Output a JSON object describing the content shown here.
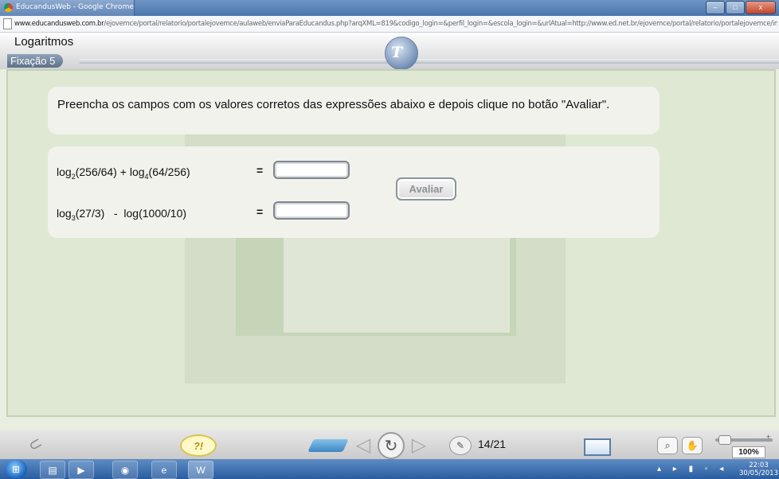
{
  "window": {
    "title": "EducandusWeb - Google Chrome",
    "minimize_glyph": "–",
    "maximize_glyph": "□",
    "close_glyph": "x"
  },
  "address_bar": {
    "url_host": "www.educandusweb.com.br",
    "url_path": "/ejovemce/portal/relatorio/portalejovemce/aulaweb/enviaParaEducandus.php?arqXML=819&codigo_login=&perfil_login=&escola_login=&urlAtual=http://www.ed.net.br/ejovemce/portal/relatorio/portalejovemce/index_9.p"
  },
  "header": {
    "title": "Logaritmos",
    "subtab": "Fixação 5",
    "logo_mark": "T"
  },
  "exercise": {
    "prompt": "Preencha os campos com os valores corretos das expressões abaixo e depois clique no botão \"Avaliar\".",
    "expr1": {
      "log1": "log",
      "base1": "2",
      "arg1": "(256/64)",
      "op": " + ",
      "log2": "log",
      "base2": "4",
      "arg2": "(64/256)"
    },
    "expr2": {
      "log1": "log",
      "base1": "3",
      "arg1": "(27/3)",
      "op": "   -  ",
      "rest": "log(1000/10)"
    },
    "equals": "=",
    "answer1_value": "",
    "answer2_value": "",
    "evaluate_label": "Avaliar"
  },
  "player_bar": {
    "hint_label": "?!",
    "prev_glyph": "◁",
    "reload_glyph": "↻",
    "next_glyph": "▷",
    "page_counter": "14/21",
    "zoom_level": "100%",
    "zoom_plus": "+"
  },
  "taskbar": {
    "clock_time": "22:03",
    "clock_date": "30/05/2013",
    "tray_glyphs": "▴ ▸ ▮ ▫ ◂"
  },
  "colors": {
    "accent_blue": "#4b75ad",
    "content_bg": "#dfe8d3",
    "panel_bg": "#f1f2ec"
  }
}
